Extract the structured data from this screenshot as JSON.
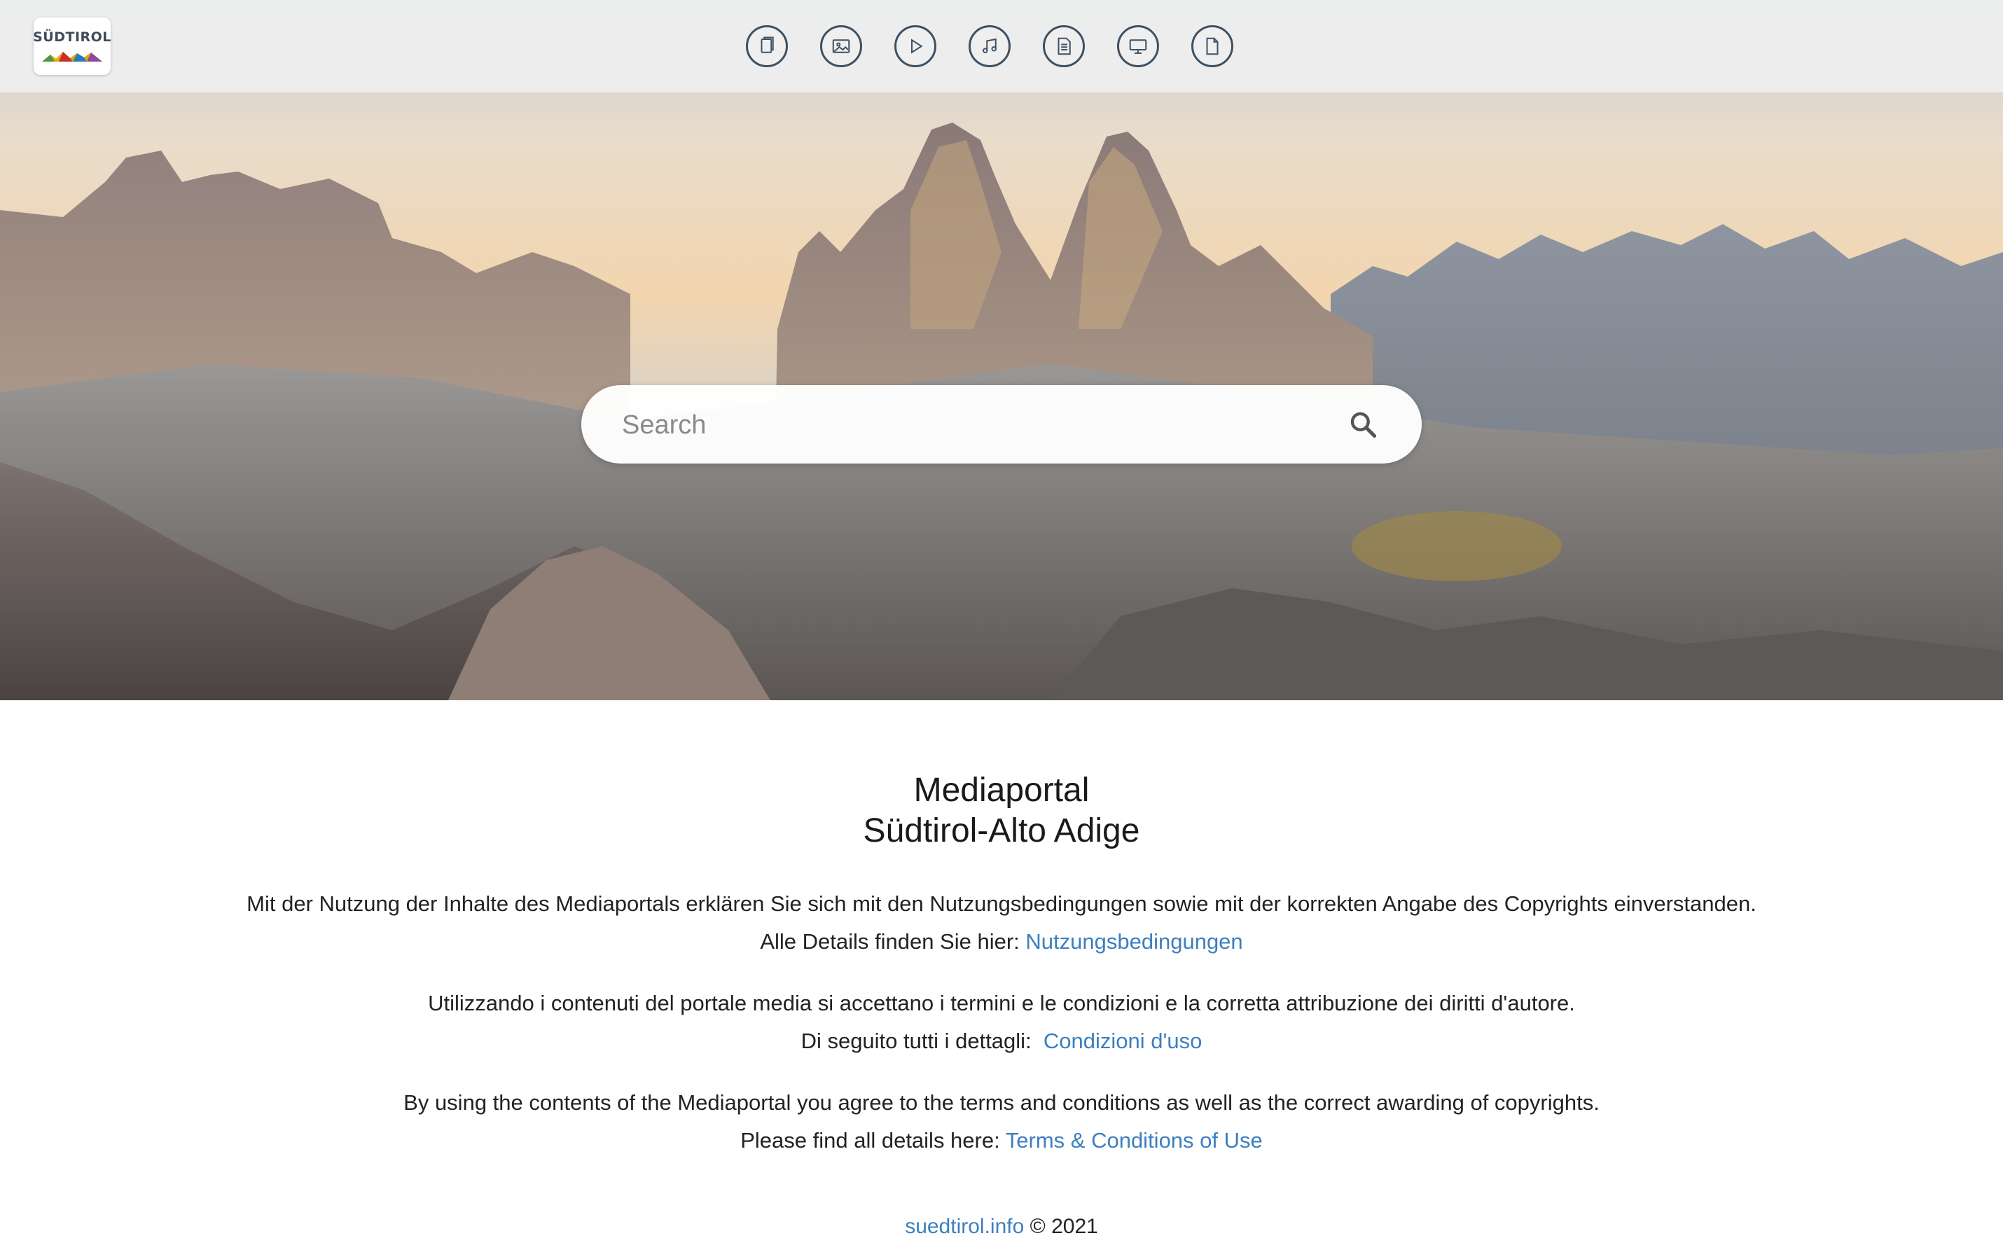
{
  "header": {
    "logo_text": "SÜDTIROL",
    "media_icons": [
      {
        "name": "documents-icon"
      },
      {
        "name": "image-icon"
      },
      {
        "name": "video-icon"
      },
      {
        "name": "audio-icon"
      },
      {
        "name": "text-document-icon"
      },
      {
        "name": "presentation-icon"
      },
      {
        "name": "file-icon"
      }
    ]
  },
  "search": {
    "placeholder": "Search"
  },
  "main": {
    "title_line1": "Mediaportal",
    "title_line2": "Südtirol-Alto Adige",
    "de": {
      "text": "Mit der Nutzung der Inhalte des Mediaportals erklären Sie sich mit den Nutzungsbedingungen sowie mit der korrekten Angabe des Copyrights einverstanden.",
      "details_prefix": "Alle Details finden Sie hier: ",
      "link": "Nutzungsbedingungen"
    },
    "it": {
      "text": "Utilizzando i contenuti del portale media si accettano i termini e le condizioni e la corretta attribuzione dei diritti d'autore.",
      "details_prefix": "Di seguito tutti i dettagli:  ",
      "link": "Condizioni d'uso"
    },
    "en": {
      "text": "By using the contents of the Mediaportal you agree to the terms and conditions as well as the correct awarding of copyrights.",
      "details_prefix": "Please find all details here: ",
      "link": "Terms & Conditions of Use"
    }
  },
  "footer": {
    "link": "suedtirol.info",
    "copyright": " © 2021"
  },
  "colors": {
    "link": "#3d7fbf",
    "icon_stroke": "#3d5163",
    "topbar": "#f0f0f0"
  }
}
